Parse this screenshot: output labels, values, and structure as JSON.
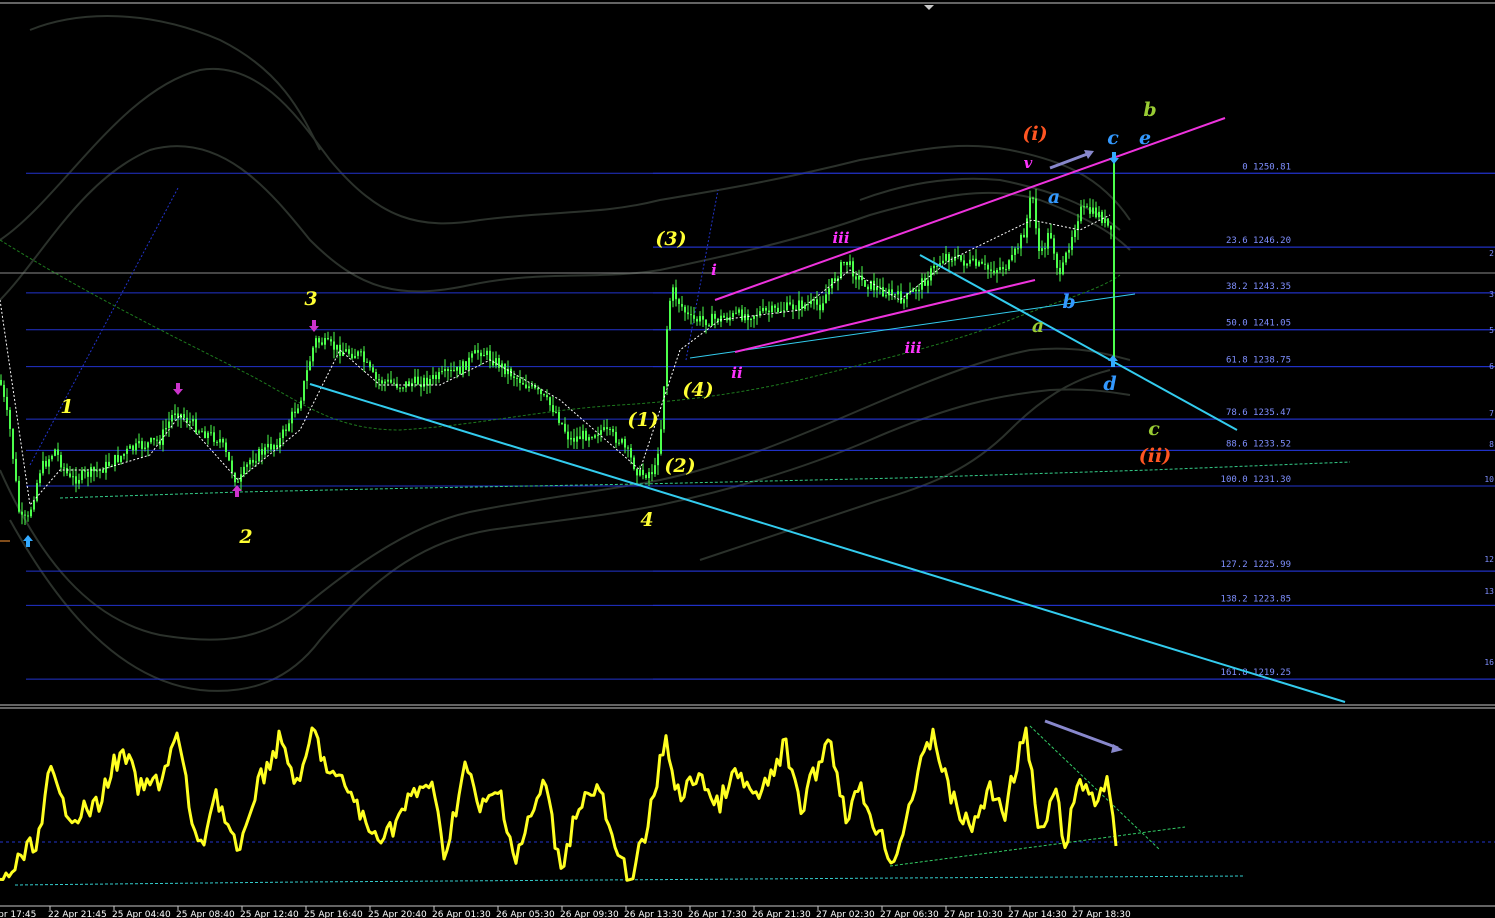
{
  "chart_data": {
    "type": "candlestick",
    "background": "#000000",
    "candle_color": "#4cff4c",
    "fibonacci_levels": [
      {
        "level": "0",
        "value": "1250.81",
        "label": "0 1250.81"
      },
      {
        "level": "23.6",
        "value": "1246.20",
        "label": "23.6 1246.20"
      },
      {
        "level": "38.2",
        "value": "1243.35",
        "label": "38.2 1243.35"
      },
      {
        "level": "50.0",
        "value": "1241.05",
        "label": "50.0 1241.05"
      },
      {
        "level": "61.8",
        "value": "1238.75",
        "label": "61.8 1238.75"
      },
      {
        "level": "78.6",
        "value": "1235.47",
        "label": "78.6 1235.47"
      },
      {
        "level": "88.6",
        "value": "1233.52",
        "label": "88.6 1233.52"
      },
      {
        "level": "100.0",
        "value": "1231.30",
        "label": "100.0 1231.30"
      },
      {
        "level": "127.2",
        "value": "1225.99",
        "label": "127.2 1225.99"
      },
      {
        "level": "138.2",
        "value": "1223.85",
        "label": "138.2 1223.85"
      },
      {
        "level": "161.8",
        "value": "1219.25",
        "label": "161.8 1219.25"
      }
    ],
    "right_edge_labels": [
      "2",
      "3",
      "5",
      "6",
      "7",
      "8",
      "10",
      "12",
      "13",
      "16"
    ],
    "wave_labels": [
      {
        "text": "1",
        "color": "#ffff33"
      },
      {
        "text": "2",
        "color": "#ffff33"
      },
      {
        "text": "3",
        "color": "#ffff33"
      },
      {
        "text": "4",
        "color": "#ffff33"
      },
      {
        "text": "(1)",
        "color": "#ffff33"
      },
      {
        "text": "(2)",
        "color": "#ffff33"
      },
      {
        "text": "(3)",
        "color": "#ffff33"
      },
      {
        "text": "(4)",
        "color": "#ffff33"
      },
      {
        "text": "i",
        "color": "#ff33ff"
      },
      {
        "text": "ii",
        "color": "#ff33ff"
      },
      {
        "text": "iii",
        "color": "#ff33ff"
      },
      {
        "text": "iii",
        "color": "#ff33ff"
      },
      {
        "text": "v",
        "color": "#ff33ff"
      },
      {
        "text": "(i)",
        "color": "#ff5522"
      },
      {
        "text": "(ii)",
        "color": "#ff5522"
      },
      {
        "text": "a",
        "color": "#3399ff"
      },
      {
        "text": "b",
        "color": "#3399ff"
      },
      {
        "text": "c",
        "color": "#3399ff"
      },
      {
        "text": "d",
        "color": "#3399ff"
      },
      {
        "text": "e",
        "color": "#3399ff"
      },
      {
        "text": "a",
        "color": "#99cc33"
      },
      {
        "text": "b",
        "color": "#99cc33"
      },
      {
        "text": "c",
        "color": "#99cc33"
      }
    ],
    "x_tick_labels": [
      "Apr 17:45",
      "22 Apr 21:45",
      "25 Apr 04:40",
      "25 Apr 08:40",
      "25 Apr 12:40",
      "25 Apr 16:40",
      "25 Apr 20:40",
      "26 Apr 01:30",
      "26 Apr 05:30",
      "26 Apr 09:30",
      "26 Apr 13:30",
      "26 Apr 17:30",
      "26 Apr 21:30",
      "27 Apr 02:30",
      "27 Apr 06:30",
      "27 Apr 10:30",
      "27 Apr 14:30",
      "27 Apr 18:30"
    ],
    "colors": {
      "fib_line": "#2233cc",
      "channel_cyan": "#33ccee",
      "channel_magenta": "#ee33dd",
      "oscillator": "#ffff22",
      "bands": "#2a2f2a"
    }
  }
}
